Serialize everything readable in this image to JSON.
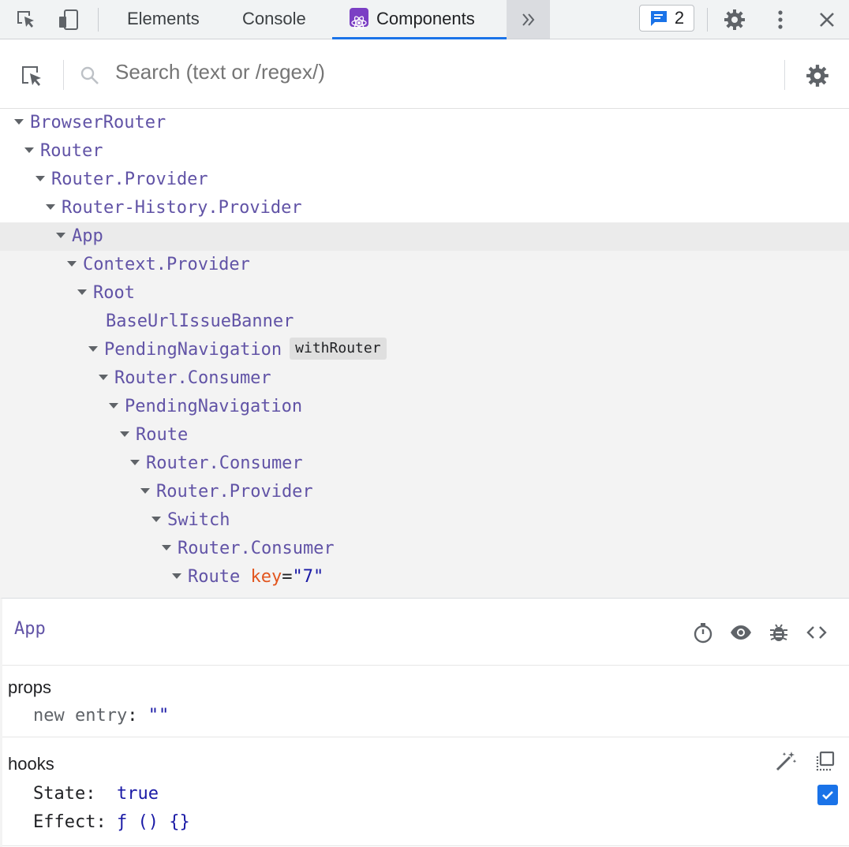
{
  "toolbar": {
    "tabs": [
      {
        "label": "Elements"
      },
      {
        "label": "Console"
      },
      {
        "label": "Components"
      }
    ],
    "message_count": "2",
    "accent": "#1a73e8"
  },
  "search": {
    "placeholder": "Search (text or /regex/)"
  },
  "tree": {
    "nodes": [
      {
        "label": "BrowserRouter"
      },
      {
        "label": "Router"
      },
      {
        "label": "Router.Provider"
      },
      {
        "label": "Router-History.Provider"
      },
      {
        "label": "App"
      },
      {
        "label": "Context.Provider"
      },
      {
        "label": "Root"
      },
      {
        "label": "BaseUrlIssueBanner"
      },
      {
        "label": "PendingNavigation",
        "badge": "withRouter"
      },
      {
        "label": "Router.Consumer"
      },
      {
        "label": "PendingNavigation"
      },
      {
        "label": "Route"
      },
      {
        "label": "Router.Consumer"
      },
      {
        "label": "Router.Provider"
      },
      {
        "label": "Switch"
      },
      {
        "label": "Router.Consumer"
      },
      {
        "label": "Route",
        "attr_key": "key",
        "attr_eq": "=",
        "attr_value": "\"7\""
      }
    ]
  },
  "details": {
    "title": "App",
    "props": {
      "title": "props",
      "entries": [
        {
          "key": "new entry",
          "sep": ":",
          "value": "\"\""
        }
      ]
    },
    "hooks": {
      "title": "hooks",
      "entries": [
        {
          "key": "State",
          "sep": ":",
          "value": "true"
        },
        {
          "key": "Effect",
          "sep": ":",
          "value": "ƒ () {}"
        }
      ]
    }
  },
  "colors": {
    "component_name": "#6153a6",
    "attr_key": "#e2561f",
    "value": "#1a1aa6",
    "selected_row": "#ebebeb"
  }
}
